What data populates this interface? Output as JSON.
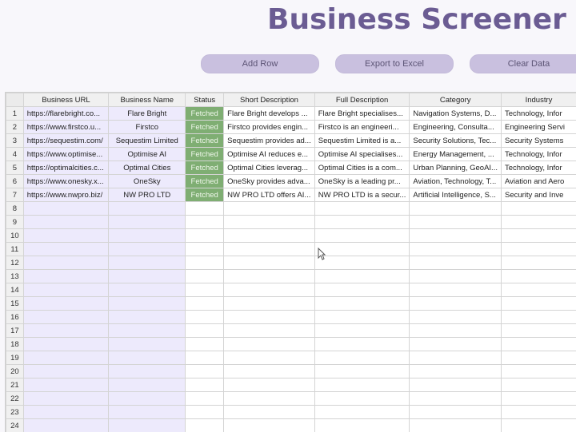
{
  "title": "Business Screener",
  "toolbar": {
    "add_row": "Add Row",
    "export": "Export to Excel",
    "clear": "Clear Data"
  },
  "columns": [
    "Business URL",
    "Business Name",
    "Status",
    "Short Description",
    "Full Description",
    "Category",
    "Industry"
  ],
  "rows": [
    [
      "1",
      "https://flarebright.co...",
      "Flare Bright",
      "Fetched",
      "Flare Bright develops ...",
      "Flare Bright specialises...",
      "Navigation Systems, D...",
      "Technology, Infor"
    ],
    [
      "2",
      "https://www.firstco.u...",
      "Firstco",
      "Fetched",
      "Firstco provides engin...",
      "Firstco is an engineeri...",
      "Engineering, Consulta...",
      "Engineering Servi"
    ],
    [
      "3",
      "https://sequestim.com/",
      "Sequestim Limited",
      "Fetched",
      "Sequestim provides ad...",
      "Sequestim Limited is a...",
      "Security Solutions, Tec...",
      "Security Systems"
    ],
    [
      "4",
      "https://www.optimise...",
      "Optimise AI",
      "Fetched",
      "Optimise AI reduces e...",
      "Optimise AI specialises...",
      "Energy Management, ...",
      "Technology, Infor"
    ],
    [
      "5",
      "https://optimalcities.c...",
      "Optimal Cities",
      "Fetched",
      "Optimal Cities leverag...",
      "Optimal Cities is a com...",
      "Urban Planning, GeoAI...",
      "Technology, Infor"
    ],
    [
      "6",
      "https://www.onesky.x...",
      "OneSky",
      "Fetched",
      "OneSky provides adva...",
      "OneSky is a leading pr...",
      "Aviation, Technology, T...",
      "Aviation and Aero"
    ],
    [
      "7",
      "https://www.nwpro.biz/",
      "NW PRO LTD",
      "Fetched",
      "NW PRO LTD offers AI...",
      "NW PRO LTD is a secur...",
      "Artificial Intelligence, S...",
      "Security and Inve"
    ]
  ],
  "empty_rows": [
    "8",
    "9",
    "10",
    "11",
    "12",
    "13",
    "14",
    "15",
    "16",
    "17",
    "18",
    "19",
    "20",
    "21",
    "22",
    "23",
    "24"
  ]
}
